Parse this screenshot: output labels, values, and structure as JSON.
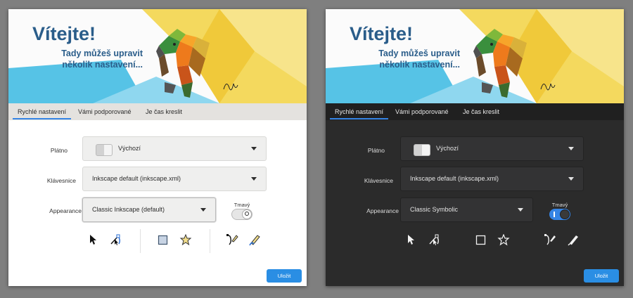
{
  "banner": {
    "title": "Vítejte!",
    "subtitle_line1": "Tady můžeš upravit",
    "subtitle_line2": "několik nastavení..."
  },
  "tabs": [
    "Rychlé nastavení",
    "Vámi podporované",
    "Je čas kreslit"
  ],
  "fields": {
    "canvas_label": "Plátno",
    "keys_label": "Klávesnice",
    "appearance_label": "Appearance"
  },
  "light": {
    "canvas_value": "Výchozí",
    "keys_value": "Inkscape default (inkscape.xml)",
    "appearance_value": "Classic Inkscape (default)",
    "dark_toggle_label": "Tmavý",
    "dark_toggle_on": false,
    "save_label": "Uložit"
  },
  "dark": {
    "canvas_value": "Výchozí",
    "keys_value": "Inkscape default (inkscape.xml)",
    "appearance_value": "Classic Symbolic",
    "dark_toggle_label": "Tmavý",
    "dark_toggle_on": true,
    "save_label": "Uložit"
  },
  "icons": [
    "select-tool-icon",
    "node-tool-icon",
    "rectangle-tool-icon",
    "star-tool-icon",
    "bezier-pen-tool-icon",
    "calligraphy-tool-icon"
  ],
  "colors": {
    "accent": "#3584e4",
    "save_button": "#2a8ee4",
    "title": "#2a5d8a",
    "dark_window": "#2b2b2b"
  }
}
